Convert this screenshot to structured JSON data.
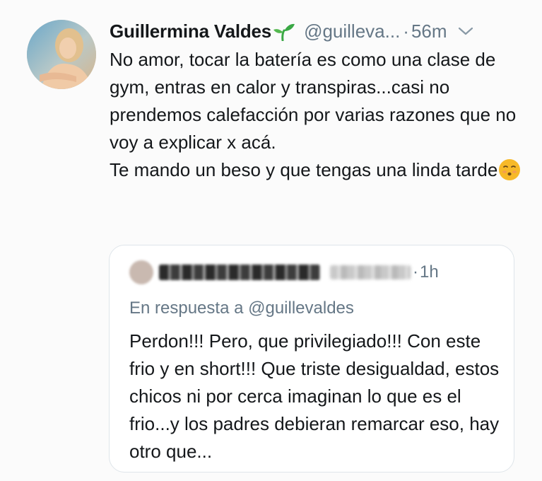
{
  "tweet": {
    "display_name": "Guillermina Valdes",
    "handle": "@guilleva...",
    "separator": "·",
    "time": "56m",
    "text": "No amor, tocar la batería es como una clase de gym, entras en calor y transpiras...casi no prendemos calefacción por varias razones que no voy a explicar x acá.\nTe mando un beso y que tengas una linda tarde",
    "icons": {
      "badge": "sprout-icon",
      "menu": "chevron-down-icon",
      "emoji": "kissing-face-emoji"
    }
  },
  "quote": {
    "separator": "·",
    "time": "1h",
    "reply_to": "En respuesta a @guillevaldes",
    "text": "Perdon!!! Pero, que privilegiado!!! Con este frio y en short!!! Que triste desigualdad, estos chicos ni por cerca imaginan lo que es el frio...y los padres debieran remarcar eso, hay otro que..."
  },
  "colors": {
    "text_primary": "#14171a",
    "text_secondary": "#657786",
    "border": "#dfe5ea",
    "sprout": "#3aa845",
    "emoji": "#f7b928"
  }
}
